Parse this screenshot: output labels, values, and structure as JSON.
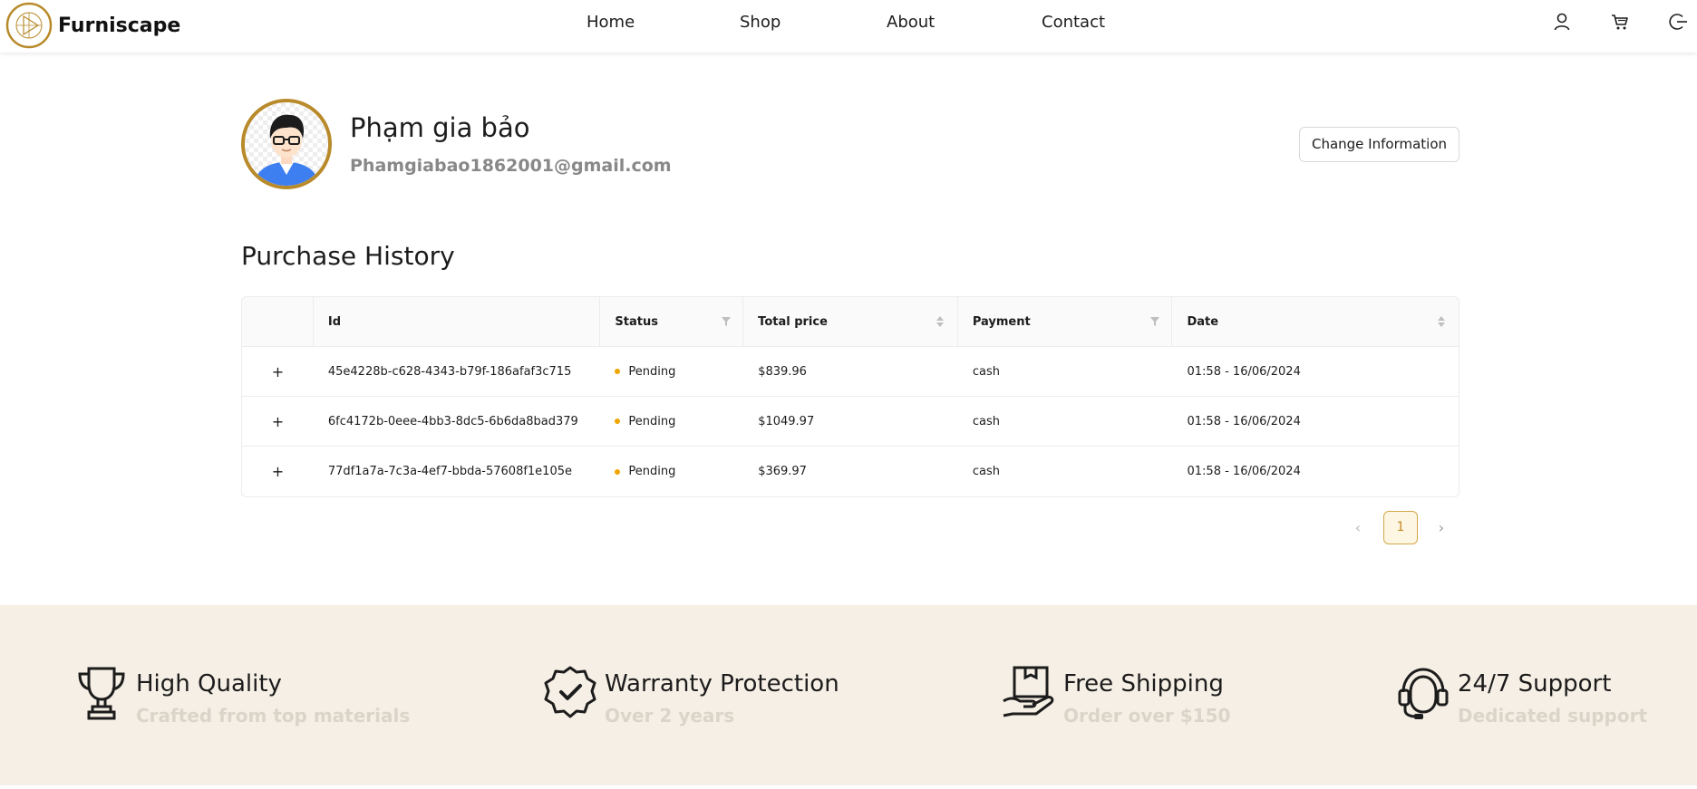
{
  "brand": {
    "name": "Furniscape"
  },
  "nav": {
    "home": "Home",
    "shop": "Shop",
    "about": "About",
    "contact": "Contact"
  },
  "header_icons": [
    "user-icon",
    "cart-icon",
    "logout-icon"
  ],
  "profile": {
    "name": "Phạm gia bảo",
    "email": "Phamgiabao1862001@gmail.com",
    "change_button": "Change Information"
  },
  "purchase_history": {
    "title": "Purchase History",
    "columns": [
      "",
      "Id",
      "Status",
      "Total price",
      "Payment",
      "Date"
    ],
    "rows": [
      {
        "expand": "+",
        "id": "45e4228b-c628-4343-b79f-186afaf3c715",
        "status": "Pending",
        "total": "$839.96",
        "payment": "cash",
        "date": "01:58 - 16/06/2024"
      },
      {
        "expand": "+",
        "id": "6fc4172b-0eee-4bb3-8dc5-6b6da8bad379",
        "status": "Pending",
        "total": "$1049.97",
        "payment": "cash",
        "date": "01:58 - 16/06/2024"
      },
      {
        "expand": "+",
        "id": "77df1a7a-7c3a-4ef7-bbda-57608f1e105e",
        "status": "Pending",
        "total": "$369.97",
        "payment": "cash",
        "date": "01:58 - 16/06/2024"
      }
    ],
    "pagination": {
      "prev": "‹",
      "current": "1",
      "next": "›"
    }
  },
  "features": [
    {
      "icon": "trophy-icon",
      "title": "High Quality",
      "subtitle": "Crafted from top materials"
    },
    {
      "icon": "badge-check-icon",
      "title": "Warranty Protection",
      "subtitle": "Over 2 years"
    },
    {
      "icon": "package-hand-icon",
      "title": "Free Shipping",
      "subtitle": "Order over $150"
    },
    {
      "icon": "headset-icon",
      "title": "24/7 Support",
      "subtitle": "Dedicated support"
    }
  ],
  "colors": {
    "accent_gold": "#b88a2a",
    "status_pending": "#f0a500",
    "features_bg": "#f6efe5"
  }
}
